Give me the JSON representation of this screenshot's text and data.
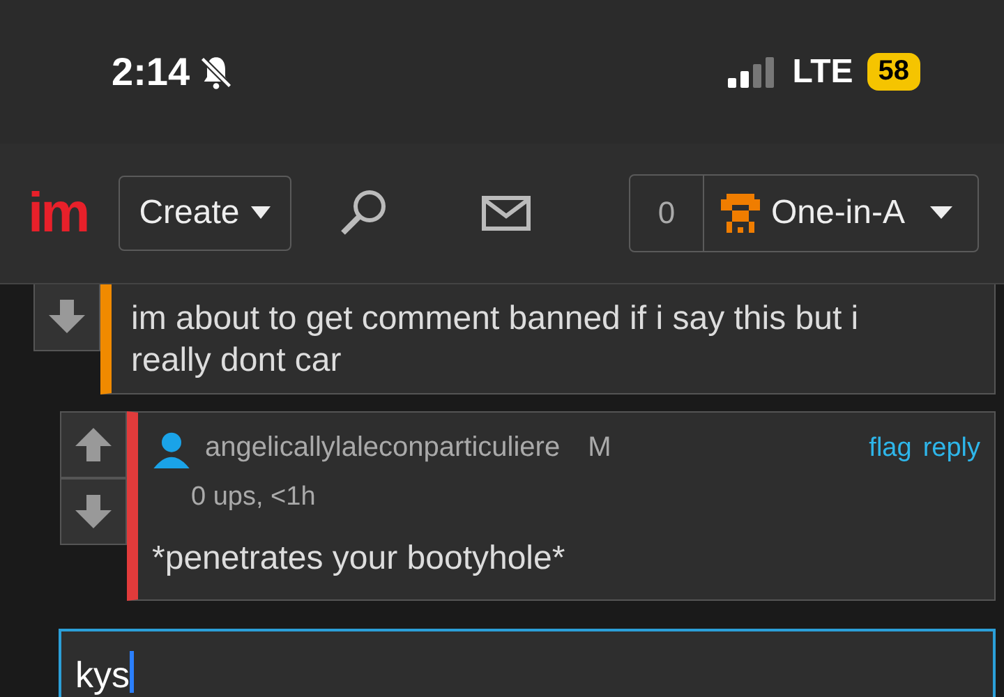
{
  "status_bar": {
    "time": "2:14",
    "silenced": true,
    "network": "LTE",
    "battery": "58"
  },
  "header": {
    "logo": "im",
    "create_button": "Create",
    "notifications": "0",
    "username": "One-in-A"
  },
  "comments": [
    {
      "text": "im about to get comment banned if i say this but i really dont car",
      "color": "#f08a00",
      "children": [
        {
          "author": "angelicallylaleconparticuliere",
          "badge": "M",
          "meta": "0 ups, <1h",
          "actions": [
            "flag",
            "reply"
          ],
          "text": "*penetrates your bootyhole*",
          "color": "#e23b3b"
        }
      ]
    }
  ],
  "reply_field": {
    "value": "kys"
  }
}
